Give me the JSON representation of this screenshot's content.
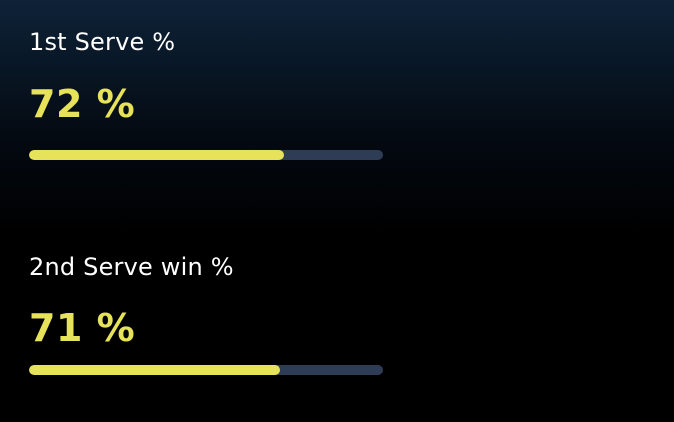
{
  "stats": [
    {
      "label": "1st Serve %",
      "value": "72 %",
      "progress": 0.72,
      "bar_color": "#e6e25a",
      "track_color": "#2e3d55"
    },
    {
      "label": "2nd Serve win %",
      "value": "71 %",
      "progress": 0.71,
      "bar_color": "#e6e25a",
      "track_color": "#2e3d55"
    }
  ]
}
